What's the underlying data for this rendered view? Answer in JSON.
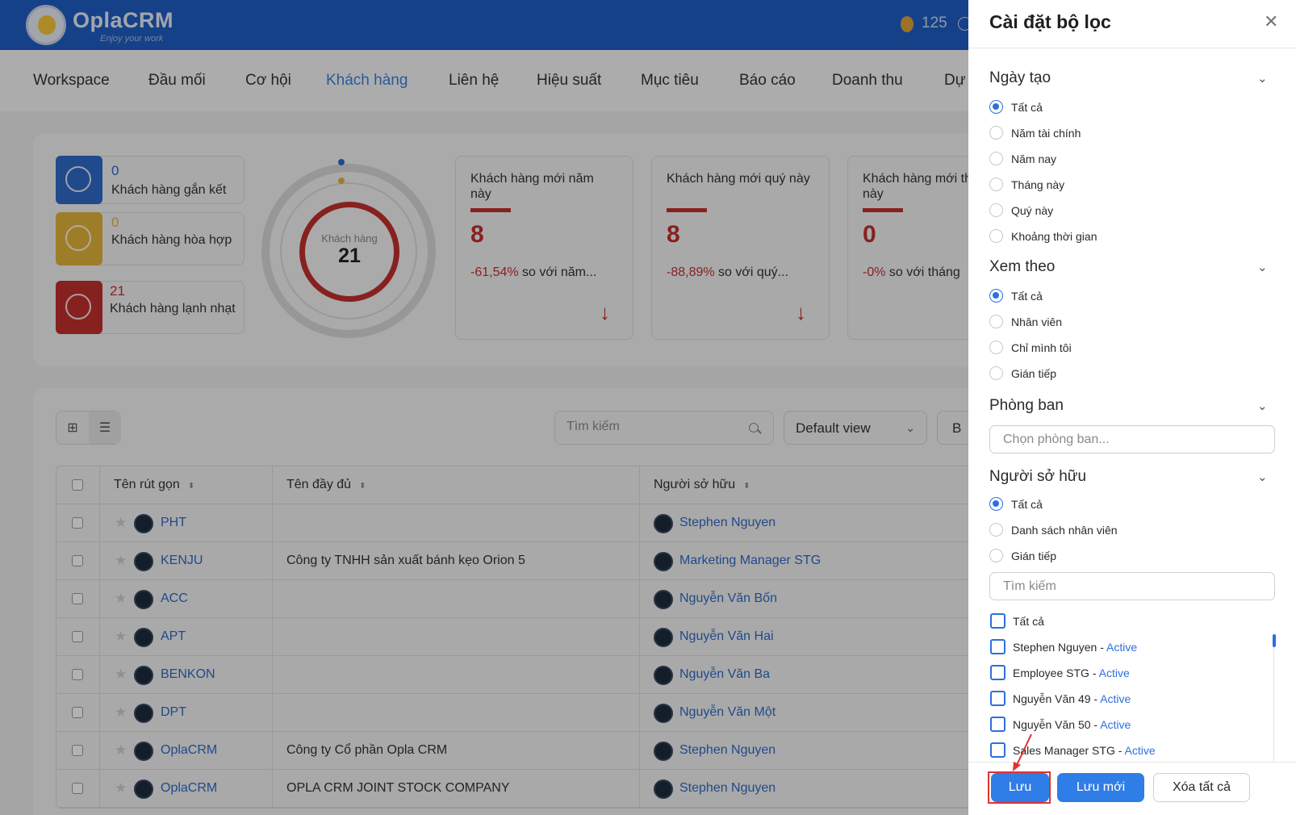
{
  "header": {
    "logo_text": "OplaCRM",
    "logo_tagline": "Enjoy your work",
    "coin_count": "125"
  },
  "nav": {
    "items": [
      {
        "label": "Workspace"
      },
      {
        "label": "Đầu mối"
      },
      {
        "label": "Cơ hội"
      },
      {
        "label": "Khách hàng",
        "active": true
      },
      {
        "label": "Liên hệ"
      },
      {
        "label": "Hiệu suất"
      },
      {
        "label": "Mục tiêu"
      },
      {
        "label": "Báo cáo"
      },
      {
        "label": "Doanh thu"
      },
      {
        "label": "Dự"
      }
    ]
  },
  "stats": {
    "moods": [
      {
        "count": "0",
        "label": "Khách hàng gắn kết",
        "color": "#2f6bc7"
      },
      {
        "count": "0",
        "label": "Khách hàng hòa hợp",
        "color": "#e2b43a"
      },
      {
        "count": "21",
        "label": "Khách hàng lạnh nhạt",
        "color": "#c2302e"
      }
    ],
    "ring": {
      "label": "Khách hàng",
      "value": "21"
    },
    "kpis": [
      {
        "title": "Khách hàng mới năm này",
        "value": "8",
        "change_pct": "-61,54%",
        "change_text": "so với năm..."
      },
      {
        "title": "Khách hàng mới quý này",
        "value": "8",
        "change_pct": "-88,89%",
        "change_text": "so với quý..."
      },
      {
        "title": "Khách hàng mới tháng này",
        "value": "0",
        "change_pct": "-0%",
        "change_text": "so với tháng"
      }
    ]
  },
  "list": {
    "search_placeholder": "Tìm kiếm",
    "view_select": "Default view",
    "extra_button": "B",
    "columns": {
      "short": "Tên rút gọn",
      "full": "Tên đầy đủ",
      "owner": "Người sở hữu"
    },
    "rows": [
      {
        "short": "PHT",
        "full": "",
        "owner": "Stephen Nguyen"
      },
      {
        "short": "KENJU",
        "full": "Công ty TNHH sản xuất bánh kẹo Orion 5",
        "owner": "Marketing Manager STG"
      },
      {
        "short": "ACC",
        "full": "",
        "owner": "Nguyễn Văn Bốn"
      },
      {
        "short": "APT",
        "full": "",
        "owner": "Nguyễn Văn Hai"
      },
      {
        "short": "BENKON",
        "full": "",
        "owner": "Nguyễn Văn Ba"
      },
      {
        "short": "DPT",
        "full": "",
        "owner": "Nguyễn Văn Một"
      },
      {
        "short": "OplaCRM",
        "full": "Công ty Cổ phần Opla CRM",
        "owner": "Stephen Nguyen"
      },
      {
        "short": "OplaCRM",
        "full": "OPLA CRM JOINT STOCK COMPANY",
        "owner": "Stephen Nguyen"
      }
    ]
  },
  "filter_panel": {
    "title": "Cài đặt bộ lọc",
    "created": {
      "title": "Ngày tạo",
      "options": [
        "Tất cả",
        "Năm tài chính",
        "Năm nay",
        "Tháng này",
        "Quý này",
        "Khoảng thời gian"
      ],
      "selected": "Tất cả"
    },
    "view_by": {
      "title": "Xem theo",
      "options": [
        "Tất cả",
        "Nhân viên",
        "Chỉ mình tôi",
        "Gián tiếp"
      ],
      "selected": "Tất cả"
    },
    "department": {
      "title": "Phòng ban",
      "placeholder": "Chọn phòng ban..."
    },
    "owner": {
      "title": "Người sở hữu",
      "options": [
        "Tất cả",
        "Danh sách nhân viên",
        "Gián tiếp"
      ],
      "selected": "Tất cả",
      "search_placeholder": "Tìm kiếm",
      "select_all_label": "Tất cả",
      "people": [
        {
          "name": "Stephen Nguyen",
          "status": "Active"
        },
        {
          "name": "Employee STG",
          "status": "Active"
        },
        {
          "name": "Nguyễn Văn 49",
          "status": "Active"
        },
        {
          "name": "Nguyễn Văn 50",
          "status": "Active"
        },
        {
          "name": "Sales Manager STG",
          "status": "Active"
        }
      ]
    },
    "buttons": {
      "save": "Lưu",
      "save_new": "Lưu mới",
      "clear_all": "Xóa tất cả"
    }
  },
  "colors": {
    "primary": "#2f7de6",
    "header": "#1f5dc4",
    "danger": "#c2302e"
  }
}
